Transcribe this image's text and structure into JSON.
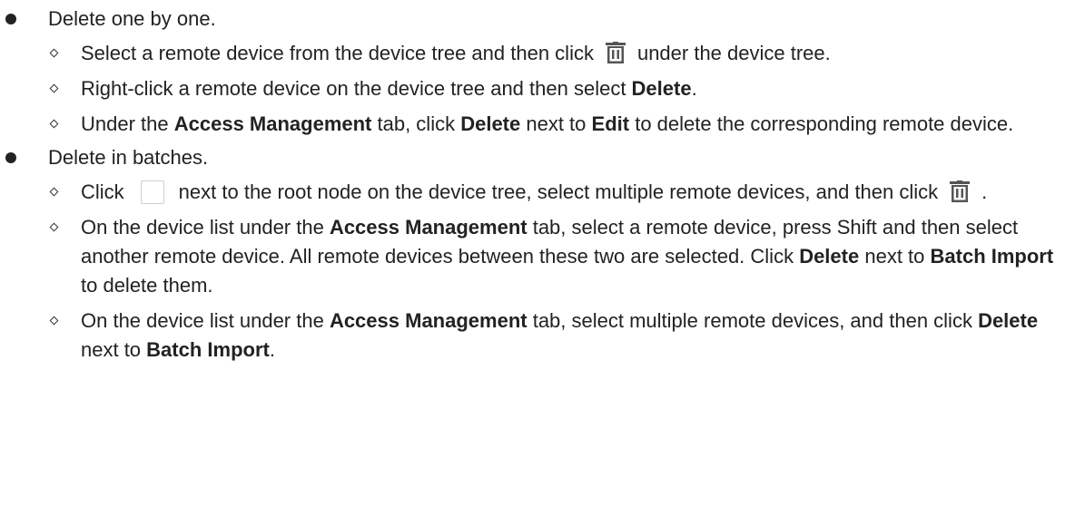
{
  "groups": [
    {
      "label": "Delete one by one.",
      "items": [
        {
          "before": "Select a remote device from the device tree and then click",
          "icon": "trash-icon",
          "after": "under the device tree."
        },
        {
          "t0": "Right-click a remote device on the device tree and then select ",
          "b0": "Delete",
          "t1": "."
        },
        {
          "t0": "Under the ",
          "b0": "Access Management",
          "t1": " tab, click ",
          "b1": "Delete",
          "t2": " next to ",
          "b2": "Edit",
          "t3": " to delete the corresponding remote device."
        }
      ]
    },
    {
      "label": "Delete in batches.",
      "items": [
        {
          "before": "Click",
          "icon": "checkbox-icon",
          "middle": "next to the root node on the device tree, select multiple remote devices, and then click",
          "icon2": "trash-icon",
          "after": "."
        },
        {
          "t0": "On the device list under the ",
          "b0": "Access Management",
          "t1": " tab, select a remote device, press Shift and then select another remote device. All remote devices between these two are selected. Click ",
          "b1": "Delete",
          "t2": " next to ",
          "b2": "Batch Import",
          "t3": " to delete them."
        },
        {
          "t0": "On the device list under the ",
          "b0": "Access Management",
          "t1": " tab, select multiple remote devices, and then click ",
          "b1": "Delete",
          "t2": " next to ",
          "b2": "Batch Import",
          "t3": "."
        }
      ]
    }
  ]
}
